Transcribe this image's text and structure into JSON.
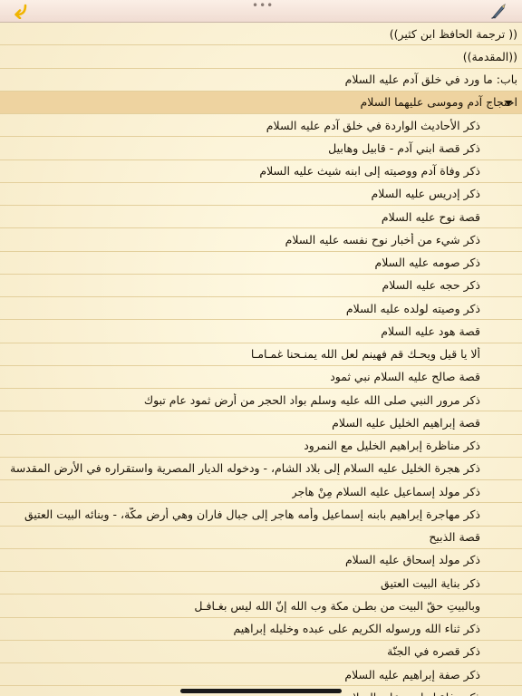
{
  "toolbar": {
    "back_icon": "back-arrow-icon",
    "menu_icon": "more-dots-icon",
    "menu_glyph": "•••",
    "tool_icon": "quill-tool-icon",
    "accent": "#f0b400"
  },
  "list": {
    "top_items": [
      "(( ترجمة الحافظ ابن كثير))",
      "((المقدمة))",
      "باب: ما ورد في خلق آدم عليه السلام"
    ],
    "selected_item": "احتجاج آدم وموسى عليهما السلام",
    "sub_items": [
      "ذكر الأحاديث الواردة في خلق آدم عليه السلام",
      "ذكر قصة ابني آدم - قابيل وهابيل",
      "ذكر وفاة آدم ووصيته إلى ابنه شيث عليه السلام",
      "ذكر إدريس عليه السلام",
      "قصة نوح عليه السلام",
      "ذكر شيء من أخبار نوح نفسه عليه السلام",
      "ذكر صومه عليه السلام",
      "ذكر حجه عليه السلام",
      "ذكر وصيته لولده عليه السلام",
      "قصة هود عليه السلام",
      "ألا يا قيل ويحـك قم فهينم لعل الله يمنـحنا غمـامـا",
      "قصة صالح عليه السلام نبي ثمود",
      "ذكر مرور النبي صلى الله عليه وسلم بواد الحجر من أرض ثمود عام تبوك",
      "قصة إبراهيم الخليل عليه السلام",
      "ذكر مناظرة إبراهيم الخليل مع النمرود",
      "ذكر هجرة الخليل عليه السلام إلى بلاد الشام، - ودخوله الديار المصرية واستقراره في الأرض المقدسة",
      "ذكر مولد إسماعيل عليه السلام مِنْ هاجر",
      "ذكر مهاجرة إبراهيم بابنه إسماعيل وأمه هاجر إلى جبال فاران وهي أرض مكّة، - وبنائه البيت العتيق",
      "قصة الذبيح",
      "ذكر مولد إسحاق عليه السلام",
      "ذكر بناية البيت العتيق",
      "وبالبيتِ حقّ البيت من بطـن مكة وب الله إنّ الله ليس بغـافـل",
      "ذكر ثناء الله ورسوله الكريم على عبده وخليله إبراهيم",
      "ذكر قصره في الجنّة",
      "ذكر صفة إبراهيم عليه السلام",
      "ذكر وفاة إبراهيم عليه السلام"
    ]
  },
  "colors": {
    "paper": "#fbf3dc",
    "selected_row": "#eed3a0",
    "divider": "#e3cf9c"
  }
}
